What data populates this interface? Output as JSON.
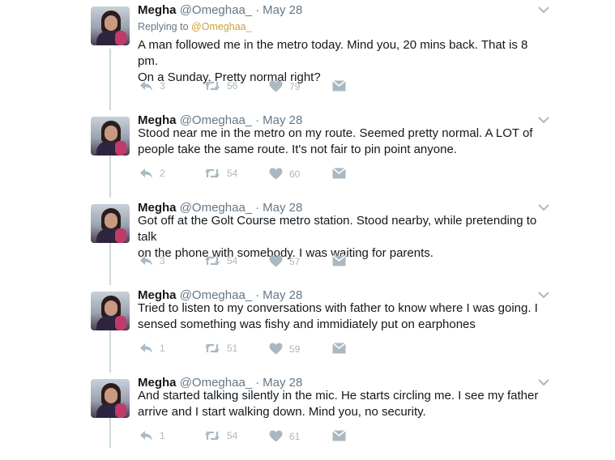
{
  "tweets": [
    {
      "name": "Megha",
      "handle": "@Omeghaa_",
      "separator": "·",
      "date": "May 28",
      "replying_label": "Replying to",
      "replying_mention": "@Omeghaa_",
      "text_lines": [
        "A man followed me in the metro today. Mind you, 20 mins back. That is 8 pm.",
        "On a Sunday. Pretty normal right?"
      ],
      "replies": "3",
      "retweets": "56",
      "likes": "79"
    },
    {
      "name": "Megha",
      "handle": "@Omeghaa_",
      "separator": "·",
      "date": "May 28",
      "text_lines": [
        "Stood near me in the metro on my route. Seemed pretty normal. A LOT of",
        "people take the same route. It's not fair to pin point anyone."
      ],
      "replies": "2",
      "retweets": "54",
      "likes": "60"
    },
    {
      "name": "Megha",
      "handle": "@Omeghaa_",
      "separator": "·",
      "date": "May 28",
      "text_lines": [
        "Got off at the Golt Course metro station. Stood nearby, while pretending to talk",
        "on the phone with somebody. I was waiting for parents."
      ],
      "replies": "3",
      "retweets": "54",
      "likes": "57"
    },
    {
      "name": "Megha",
      "handle": "@Omeghaa_",
      "separator": "·",
      "date": "May 28",
      "text_lines": [
        "Tried to listen to my conversations with father to know where I was going. I",
        "sensed something was fishy and immidiately put on earphones"
      ],
      "replies": "1",
      "retweets": "51",
      "likes": "59"
    },
    {
      "name": "Megha",
      "handle": "@Omeghaa_",
      "separator": "·",
      "date": "May 28",
      "text_lines": [
        "And started talking silently in the mic. He starts circling me. I see my father",
        "arrive and I start walking down. Mind you, no security."
      ],
      "replies": "1",
      "retweets": "54",
      "likes": "61"
    }
  ],
  "icons": {
    "reply": "reply-icon",
    "retweet": "retweet-icon",
    "like": "heart-icon",
    "message": "envelope-icon",
    "more": "chevron-down-icon"
  },
  "colors": {
    "icon_gray": "#aab8c2",
    "meta_gray": "#657786",
    "mention": "#c8a23f",
    "thread_line": "#ccd6dd"
  }
}
